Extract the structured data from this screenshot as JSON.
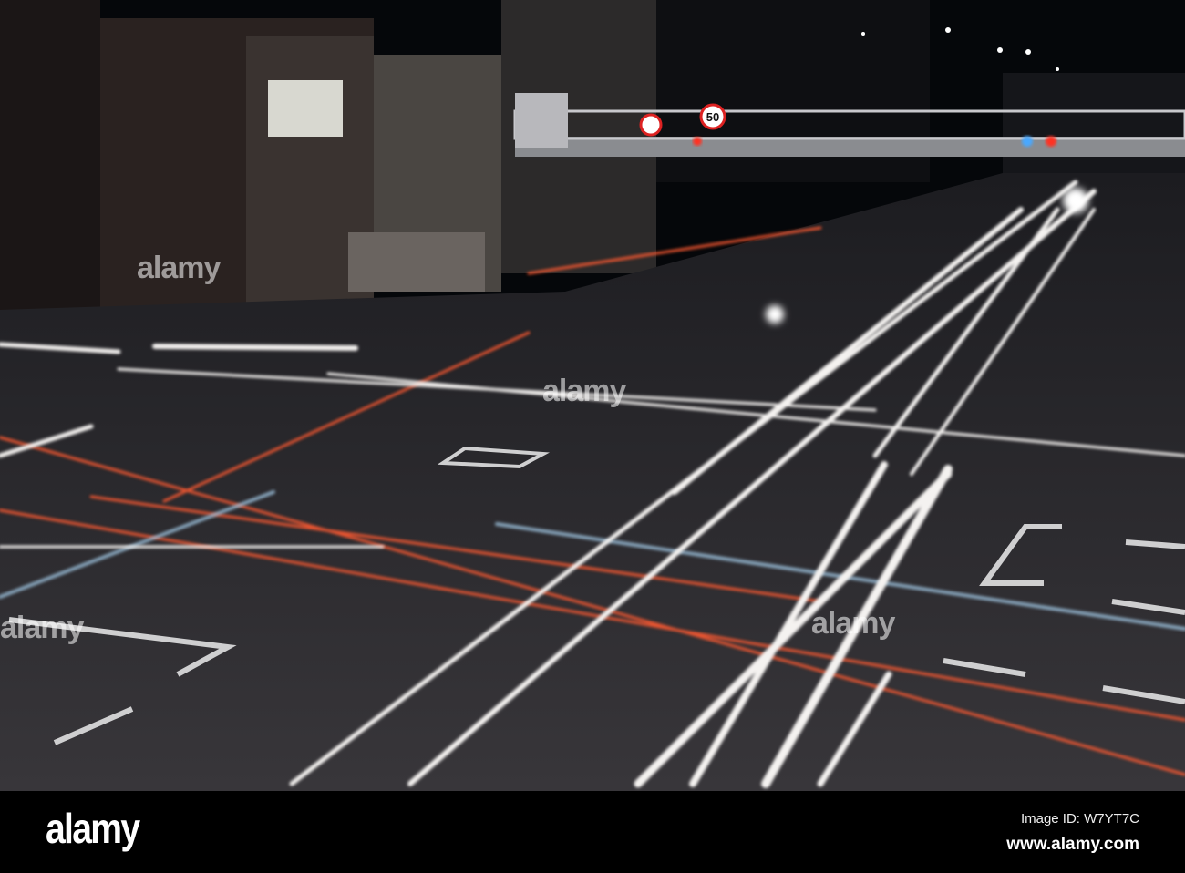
{
  "photo": {
    "speed_sign": "50",
    "colors": {
      "sky": "#05070a",
      "road": "#2a2a2e",
      "streak_white": "#f4f2f0",
      "streak_red": "#ff5a30",
      "streak_blue": "#9fc4e0"
    }
  },
  "watermark": {
    "text": "alamy"
  },
  "footer": {
    "logo": "alamy",
    "image_id": "Image ID: W7YT7C",
    "url": "www.alamy.com"
  }
}
